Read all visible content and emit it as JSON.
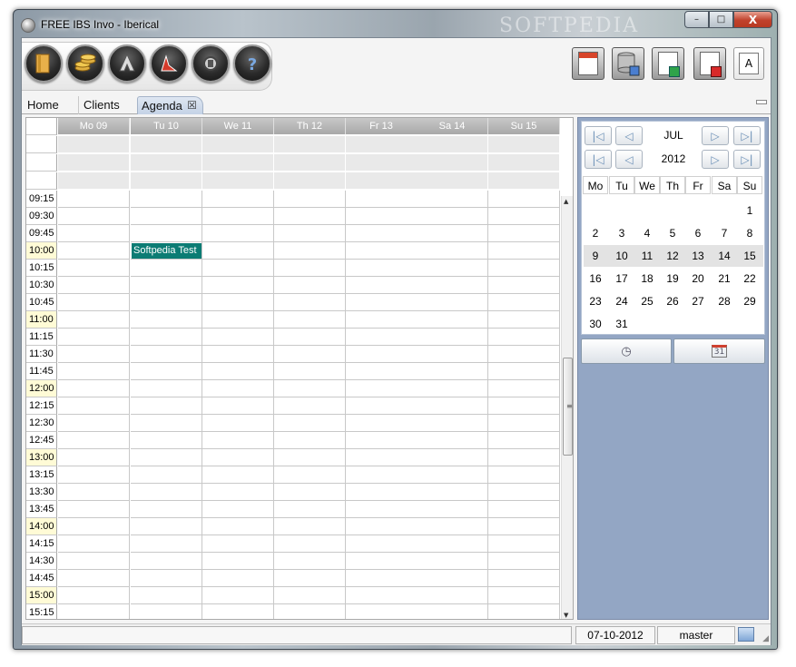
{
  "window": {
    "title": "FREE IBS Invo - Iberical",
    "watermark": "SOFTPEDIA",
    "buttons": {
      "minimize": "–",
      "maximize": "□",
      "close": "X"
    }
  },
  "toolbar": {
    "left_buttons": [
      {
        "name": "book-icon",
        "color": "#e8b04a"
      },
      {
        "name": "coins-icon",
        "color": "#e0b040"
      },
      {
        "name": "tree-icon",
        "color": "#dcdcdc"
      },
      {
        "name": "chart-icon",
        "color": "#d43a2a"
      },
      {
        "name": "tools-icon",
        "color": "#cfcfcf"
      },
      {
        "name": "help-icon",
        "color": "#7aa8e0"
      }
    ],
    "right_buttons": [
      {
        "name": "calendar-doc-icon",
        "accent": "#d8452a"
      },
      {
        "name": "database-save-icon",
        "accent": "#4a7ed0"
      },
      {
        "name": "export-green-icon",
        "accent": "#2fa34a"
      },
      {
        "name": "export-red-icon",
        "accent": "#d82a2a"
      }
    ],
    "text_button": "A"
  },
  "tabs": [
    {
      "label": "Home"
    },
    {
      "label": "Clients"
    },
    {
      "label": "Agenda",
      "close": "☒"
    }
  ],
  "agenda": {
    "days": [
      "Mo 09",
      "Tu 10",
      "We 11",
      "Th 12",
      "Fr 13",
      "Sa 14",
      "Su 15"
    ],
    "times": [
      "09:15",
      "09:30",
      "09:45",
      "10:00",
      "10:15",
      "10:30",
      "10:45",
      "11:00",
      "11:15",
      "11:30",
      "11:45",
      "12:00",
      "12:15",
      "12:30",
      "12:45",
      "13:00",
      "13:15",
      "13:30",
      "13:45",
      "14:00",
      "14:15",
      "14:30",
      "14:45",
      "15:00",
      "15:15"
    ],
    "hour_marks": [
      "10:00",
      "11:00",
      "12:00",
      "13:00",
      "14:00",
      "15:00"
    ],
    "events": [
      {
        "title": "Softpedia Test",
        "day": "Tu 10",
        "time": "10:00",
        "color": "#0c7c74"
      }
    ],
    "scroll": {
      "up": "▲",
      "down": "▼",
      "grip": "≡"
    }
  },
  "calendar": {
    "month": "JUL",
    "year": "2012",
    "nav": {
      "first": "|◁",
      "prev": "◁",
      "next": "▷",
      "last": "▷|"
    },
    "weekdays": [
      "Mo",
      "Tu",
      "We",
      "Th",
      "Fr",
      "Sa",
      "Su"
    ],
    "weeks": [
      [
        "",
        "",
        "",
        "",
        "",
        "",
        "1"
      ],
      [
        "2",
        "3",
        "4",
        "5",
        "6",
        "7",
        "8"
      ],
      [
        "9",
        "10",
        "11",
        "12",
        "13",
        "14",
        "15"
      ],
      [
        "16",
        "17",
        "18",
        "19",
        "20",
        "21",
        "22"
      ],
      [
        "23",
        "24",
        "25",
        "26",
        "27",
        "28",
        "29"
      ],
      [
        "30",
        "31",
        "",
        "",
        "",
        "",
        ""
      ]
    ],
    "highlighted_week": 2,
    "buttons": [
      {
        "name": "today-clock-icon",
        "glyph": "◷"
      },
      {
        "name": "calendar-31-icon",
        "glyph": "31"
      }
    ]
  },
  "statusbar": {
    "date": "07-10-2012",
    "user": "master"
  }
}
